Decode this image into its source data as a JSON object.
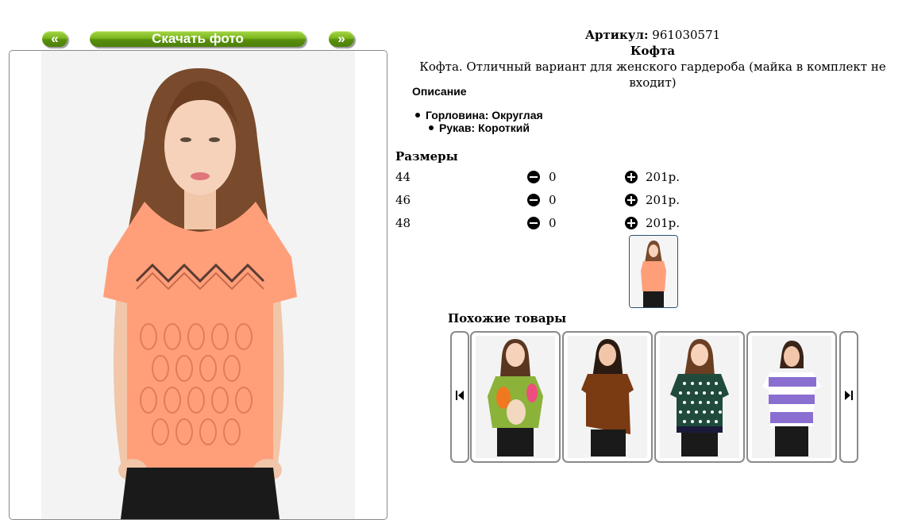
{
  "gallery": {
    "prev_label": "«",
    "download_label": "Скачать фото",
    "next_label": "»"
  },
  "product": {
    "article_label": "Артикул:",
    "article_value": "961030571",
    "name": "Кофта",
    "short_description": "Кофта. Отличный вариант для женского гардероба (майка в комплект не входит)"
  },
  "description": {
    "title": "Описание",
    "features": [
      "Горловина: Округлая",
      "Рукав: Короткий"
    ]
  },
  "sizes": {
    "title": "Размеры",
    "rows": [
      {
        "size": "44",
        "qty": "0",
        "price": "201р."
      },
      {
        "size": "46",
        "qty": "0",
        "price": "201р."
      },
      {
        "size": "48",
        "qty": "0",
        "price": "201р."
      }
    ]
  },
  "similar": {
    "title": "Похожие товары",
    "prev_icon": "skip-previous-icon",
    "next_icon": "skip-next-icon"
  },
  "colors": {
    "button_green": "#7cb61e",
    "thumb_border": "#2f4f6f",
    "main_blouse": "#ff9f7a",
    "card1_blouse": "#8bb33a",
    "card2_blouse": "#7a3a12",
    "card3_blouse": "#1f4a3c",
    "card4_blouse": "#8a6fd1"
  }
}
